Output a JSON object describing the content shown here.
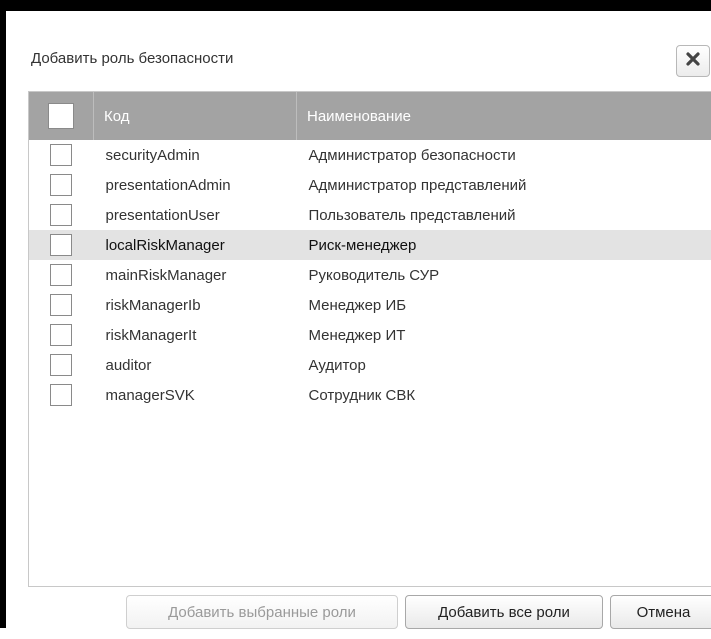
{
  "dialog": {
    "title": "Добавить роль безопасности",
    "close_icon": "close-icon"
  },
  "grid": {
    "columns": {
      "code": "Код",
      "name": "Наименование"
    },
    "rows": [
      {
        "code": "securityAdmin",
        "name": "Администратор безопасности",
        "checked": false,
        "highlighted": false
      },
      {
        "code": "presentationAdmin",
        "name": "Администратор представлений",
        "checked": false,
        "highlighted": false
      },
      {
        "code": "presentationUser",
        "name": "Пользователь представлений",
        "checked": false,
        "highlighted": false
      },
      {
        "code": "localRiskManager",
        "name": "Риск-менеджер",
        "checked": false,
        "highlighted": true
      },
      {
        "code": "mainRiskManager",
        "name": "Руководитель СУР",
        "checked": false,
        "highlighted": false
      },
      {
        "code": "riskManagerIb",
        "name": "Менеджер ИБ",
        "checked": false,
        "highlighted": false
      },
      {
        "code": "riskManagerIt",
        "name": "Менеджер ИТ",
        "checked": false,
        "highlighted": false
      },
      {
        "code": "auditor",
        "name": "Аудитор",
        "checked": false,
        "highlighted": false
      },
      {
        "code": "managerSVK",
        "name": "Сотрудник СВК",
        "checked": false,
        "highlighted": false
      }
    ]
  },
  "footer": {
    "add_selected_label": "Добавить выбранные роли",
    "add_all_label": "Добавить все роли",
    "cancel_label": "Отмена"
  },
  "colors": {
    "header_bg": "#a3a3a3",
    "highlight_row_bg": "#e3e3e3",
    "frame_border": "#000000"
  }
}
